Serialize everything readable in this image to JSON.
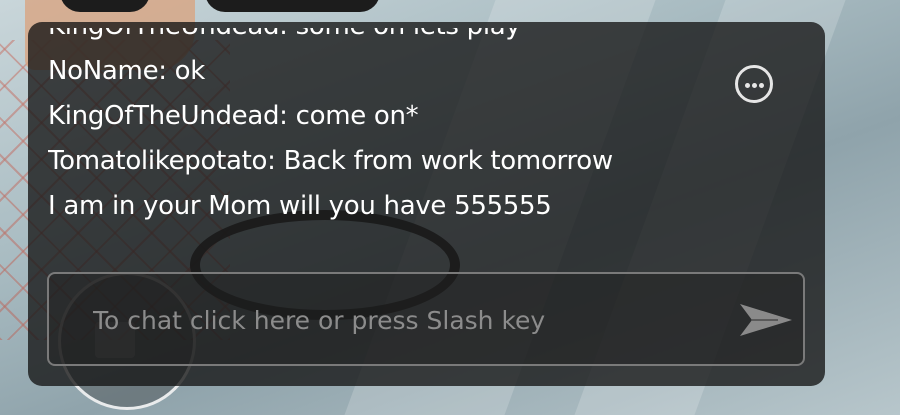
{
  "chat": {
    "messages": [
      "KingOfTheUndead: some on lets play",
      "NoName: ok",
      "KingOfTheUndead: come on*",
      "Tomatolikepotato: Back from work tomorrow",
      "I am in your Mom will you have 555555"
    ],
    "more_icon": "more-options-icon",
    "input_placeholder": "To chat click here or press Slash key",
    "input_value": "",
    "send_icon": "send-arrow-icon"
  },
  "colors": {
    "chat_background": "#141414",
    "chat_text": "#ffffff",
    "placeholder_text": "#8c8c8c",
    "input_border": "#7a7a7a"
  }
}
